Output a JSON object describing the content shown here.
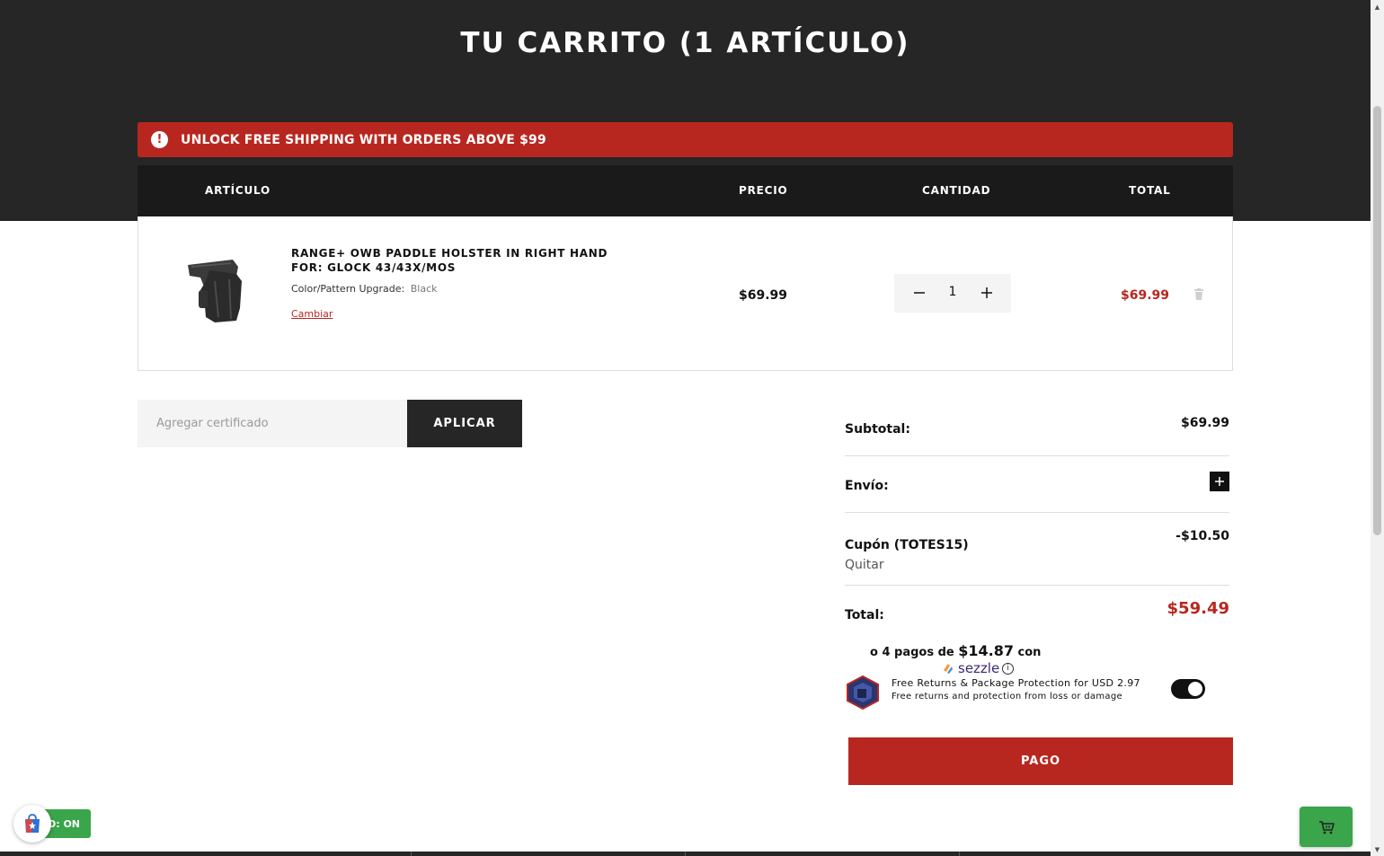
{
  "header": {
    "title": "TU CARRITO (1 ARTÍCULO)"
  },
  "banner": {
    "text": "UNLOCK FREE SHIPPING WITH ORDERS ABOVE $99",
    "icon": "alert-icon",
    "color": "#b8271f"
  },
  "table": {
    "headers": {
      "item": "ARTÍCULO",
      "price": "PRECIO",
      "quantity": "CANTIDAD",
      "total": "TOTAL"
    },
    "row": {
      "title": "RANGE+ OWB PADDLE HOLSTER IN RIGHT HAND FOR: GLOCK 43/43X/MOS",
      "option_label": "Color/Pattern Upgrade:",
      "option_value": "Black",
      "change_link": "Cambiar",
      "price": "$69.99",
      "quantity": "1",
      "total": "$69.99"
    }
  },
  "certificate": {
    "placeholder": "Agregar certificado",
    "apply_label": "APLICAR"
  },
  "summary": {
    "subtotal_label": "Subtotal:",
    "subtotal_value": "$69.99",
    "shipping_label": "Envío:",
    "coupon_label": "Cupón (TOTES15)",
    "coupon_value": "-$10.50",
    "coupon_remove": "Quitar",
    "total_label": "Total:",
    "total_value": "$59.49"
  },
  "sezzle": {
    "prefix": "o 4 pagos de",
    "amount": "$14.87",
    "suffix": "con",
    "brand": "sezzle",
    "info_icon": "info-icon"
  },
  "protection": {
    "title": "Free Returns & Package Protection for USD 2.97",
    "subtitle": "Free returns and protection from loss or damage",
    "enabled": true
  },
  "checkout": {
    "label": "PAGO"
  },
  "promo_widget": {
    "text": "O: ON"
  },
  "colors": {
    "accent": "#b8271f",
    "dark": "#262626",
    "green": "#3aa54a"
  }
}
